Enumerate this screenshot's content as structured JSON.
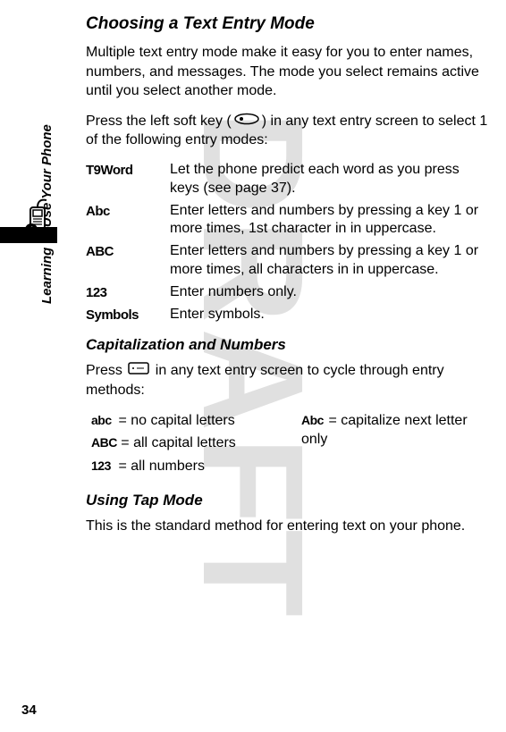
{
  "watermark": "DRAFT",
  "side_tab": "Learning to Use Your Phone",
  "page_number": "34",
  "section1": {
    "heading": "Choosing a Text Entry Mode",
    "para1": "Multiple text entry mode make it easy for you to enter names, numbers, and messages. The mode you select remains active until you select another mode.",
    "para2a": "Press the left soft key (",
    "para2b": ") in any text entry screen to select 1 of the following entry modes:",
    "modes": [
      {
        "term": "T9Word",
        "desc": "Let the phone predict each word as you press keys (see page 37)."
      },
      {
        "term": "Abc",
        "desc": "Enter letters and numbers by pressing a key 1 or more times, 1st character in in uppercase."
      },
      {
        "term": "ABC",
        "desc": "Enter letters and numbers by pressing a key 1 or more times, all characters in in uppercase."
      },
      {
        "term": "123",
        "desc": "Enter numbers only."
      },
      {
        "term": "Symbols",
        "desc": "Enter symbols."
      }
    ]
  },
  "section2": {
    "heading": "Capitalization and Numbers",
    "para_a": "Press ",
    "para_b": " in any text entry screen to cycle through entry methods:",
    "left_items": [
      {
        "term": "abc",
        "desc": " = no capital letters"
      },
      {
        "term": "ABC",
        "desc": " = all capital letters"
      },
      {
        "term": "123",
        "desc": " = all numbers"
      }
    ],
    "right_item": {
      "term": "Abc",
      "desc": " = capitalize next letter only"
    }
  },
  "section3": {
    "heading": "Using Tap Mode",
    "para": "This is the standard method for entering text on your phone."
  }
}
